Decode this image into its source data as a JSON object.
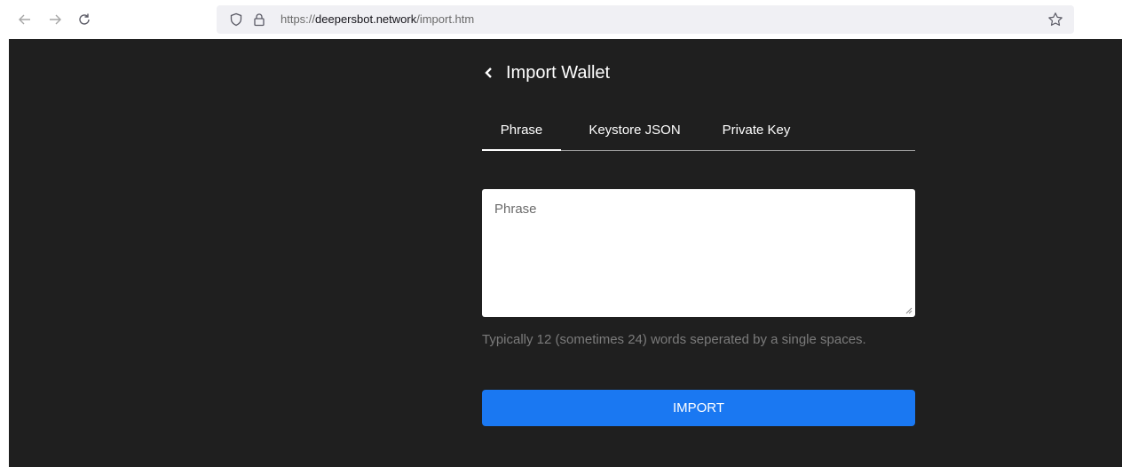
{
  "browser": {
    "url_scheme": "https://",
    "url_host": "deepersbot.network",
    "url_path": "/import.htm",
    "icons": {
      "back": "arrow-left-icon",
      "forward": "arrow-right-icon",
      "reload": "reload-icon",
      "tracking": "shield-icon",
      "secure": "lock-icon",
      "bookmark": "star-icon"
    }
  },
  "page": {
    "title": "Import Wallet",
    "tabs": [
      {
        "label": "Phrase",
        "active": true
      },
      {
        "label": "Keystore JSON",
        "active": false
      },
      {
        "label": "Private Key",
        "active": false
      }
    ],
    "phrase_input": {
      "placeholder": "Phrase",
      "value": ""
    },
    "hint": "Typically 12 (sometimes 24) words seperated by a single spaces.",
    "import_button": "IMPORT"
  },
  "colors": {
    "page_background": "#1f1f1f",
    "primary_button": "#1a78f2"
  }
}
